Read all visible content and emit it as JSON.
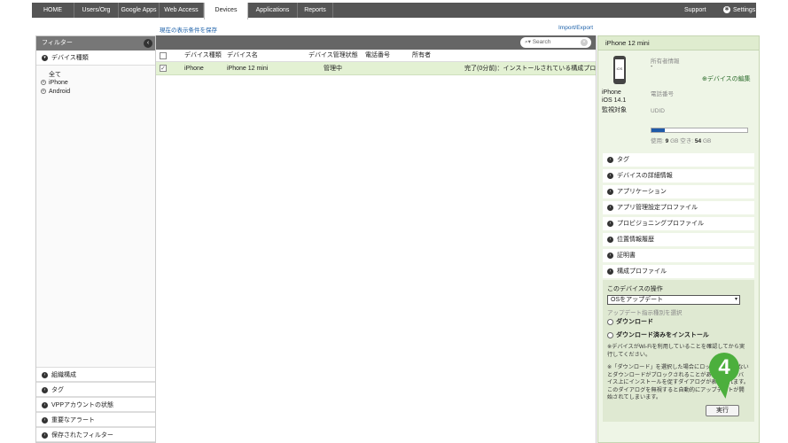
{
  "nav": {
    "items": [
      "HOME",
      "Users/Org",
      "Google Apps",
      "Web Access",
      "Devices",
      "Applications",
      "Reports"
    ],
    "active": "Devices",
    "support": "Support",
    "settings": "Settings"
  },
  "links": {
    "save_view": "現在の表示条件を保存",
    "import_export": "Import/Export"
  },
  "filter": {
    "header": "フィルター",
    "device_type_section": "デバイス種類",
    "all": "全て",
    "options": [
      "iPhone",
      "Android"
    ],
    "bottom_sections": [
      "組織構成",
      "タグ",
      "VPPアカウントの状態",
      "重要なアラート",
      "保存されたフィルター"
    ]
  },
  "table": {
    "search_placeholder": "Search",
    "columns": [
      "デバイス種類",
      "デバイス名",
      "デバイス管理状態",
      "電話番号",
      "所有者"
    ],
    "rows": [
      {
        "type": "iPhone",
        "name": "iPhone 12 mini",
        "status": "管理中",
        "phone": "",
        "owner": "",
        "extra": "完了(0分前)：インストールされている構成プロ..."
      }
    ]
  },
  "detail": {
    "title": "iPhone 12 mini",
    "icon_text": "iOS",
    "model": "iPhone",
    "os": "iOS 14.1",
    "supervised": "監視対象",
    "owner_label": "所有者情報",
    "owner_value": "-",
    "edit_link": "デバイスの編集",
    "phone_label": "電話番号",
    "udid_label": "UDID",
    "storage": {
      "used_label": "使用:",
      "used_value": "9",
      "used_unit": "GB",
      "free_label": "空き:",
      "free_value": "54",
      "free_unit": "GB",
      "used_fraction": 0.14
    },
    "sections": [
      "タグ",
      "デバイスの詳細情報",
      "アプリケーション",
      "アプリ管理設定プロファイル",
      "プロビジョニングプロファイル",
      "位置情報履歴",
      "証明書",
      "構成プロファイル"
    ],
    "operation": {
      "title": "このデバイスの操作",
      "selected": "OSをアップデート",
      "sub_label": "アップデート指示種別を選択",
      "radio1": "ダウンロード",
      "radio2": "ダウンロード済みをインストール",
      "note1": "※デバイスがWi-Fiを利用していることを確認してから実行してください。",
      "note2": "※「ダウンロード」を選択した場合にロックされていないとダウンロードがブロックされることがあります。デバイス上にインストールを促すダイアログが表示されます。このダイアログを無視すると自動的にアップデートが開始されてしまいます。",
      "exec_button": "実行"
    }
  },
  "step_badge": "4",
  "colors": {
    "accent": "#4caf3d",
    "nav": "#555555",
    "selected_row": "#e3f1d3"
  }
}
